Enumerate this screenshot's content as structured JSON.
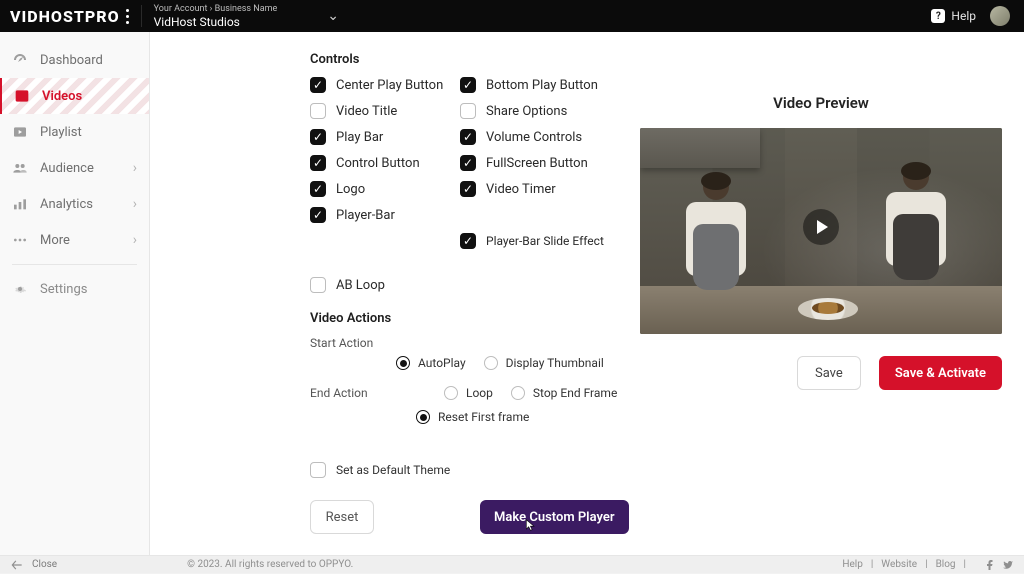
{
  "brand": "VIDHOSTPRO",
  "account_label": "Your Account › Business Name",
  "studio_name": "VidHost Studios",
  "help_label": "Help",
  "sidebar": {
    "items": [
      {
        "label": "Dashboard",
        "icon": "gauge-icon",
        "hasChevron": false
      },
      {
        "label": "Videos",
        "icon": "play-square-icon",
        "hasChevron": false,
        "active": true
      },
      {
        "label": "Playlist",
        "icon": "list-play-icon",
        "hasChevron": false
      },
      {
        "label": "Audience",
        "icon": "people-icon",
        "hasChevron": true
      },
      {
        "label": "Analytics",
        "icon": "chart-icon",
        "hasChevron": true
      },
      {
        "label": "More",
        "icon": "dots-icon",
        "hasChevron": true
      },
      {
        "label": "Settings",
        "icon": "gear-icon",
        "hasChevron": false
      }
    ]
  },
  "sections": {
    "controls_title": "Controls",
    "actions_title": "Video Actions",
    "start_action_label": "Start Action",
    "end_action_label": "End Action"
  },
  "controls": {
    "center_play": {
      "label": "Center Play Button",
      "checked": true
    },
    "bottom_play": {
      "label": "Bottom Play Button",
      "checked": true
    },
    "video_title": {
      "label": "Video Title",
      "checked": false
    },
    "share_options": {
      "label": "Share Options",
      "checked": false
    },
    "play_bar": {
      "label": "Play Bar",
      "checked": true
    },
    "volume_controls": {
      "label": "Volume Controls",
      "checked": true
    },
    "control_button": {
      "label": "Control Button",
      "checked": true
    },
    "fullscreen": {
      "label": "FullScreen Button",
      "checked": true
    },
    "logo": {
      "label": "Logo",
      "checked": true
    },
    "video_timer": {
      "label": "Video Timer",
      "checked": true
    },
    "player_bar": {
      "label": "Player-Bar",
      "checked": true
    },
    "player_bar_slide": {
      "label": "Player-Bar Slide Effect",
      "checked": true
    },
    "ab_loop": {
      "label": "AB Loop",
      "checked": false
    }
  },
  "start_options": {
    "autoplay": {
      "label": "AutoPlay",
      "selected": true
    },
    "display_thumbnail": {
      "label": "Display Thumbnail",
      "selected": false
    }
  },
  "end_options": {
    "loop": {
      "label": "Loop",
      "selected": false
    },
    "stop_end_frame": {
      "label": "Stop End Frame",
      "selected": false
    },
    "reset_first_frame": {
      "label": "Reset First frame",
      "selected": true
    }
  },
  "default_theme": {
    "label": "Set as Default Theme",
    "checked": false
  },
  "buttons": {
    "reset": "Reset",
    "make_custom": "Make Custom Player",
    "save": "Save",
    "save_activate": "Save & Activate"
  },
  "preview": {
    "title": "Video Preview"
  },
  "footer": {
    "close": "Close",
    "copyright": "©  2023. All rights reserved to OPPYO.",
    "links": [
      "Help",
      "Website",
      "Blog"
    ]
  },
  "colors": {
    "accent": "#d5112a",
    "primary": "#3b1b62",
    "black": "#0b0b0b"
  }
}
